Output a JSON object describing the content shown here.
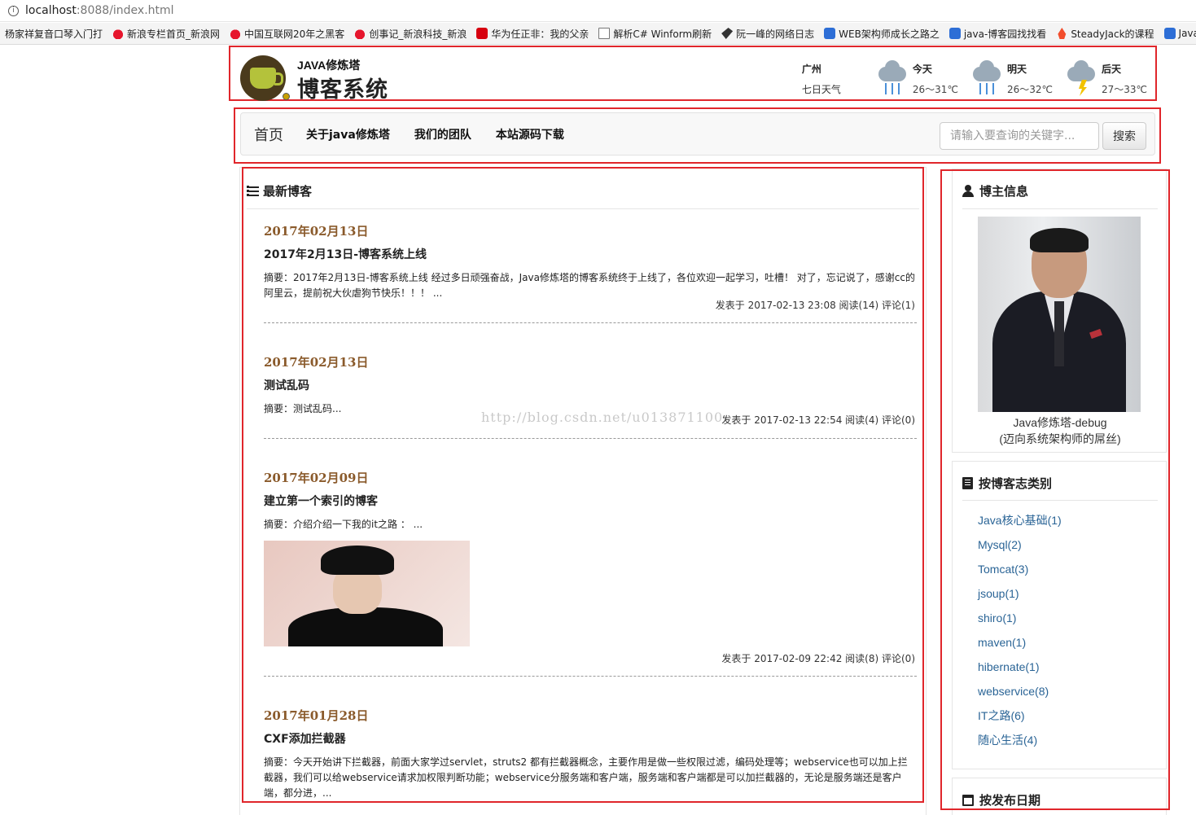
{
  "browser": {
    "url_host": "localhost",
    "url_rest": ":8088/index.html",
    "bookmarks": [
      {
        "icon": "plain",
        "label": "杨家祥复音口琴入门打"
      },
      {
        "icon": "weibo",
        "label": "新浪专栏首页_新浪网"
      },
      {
        "icon": "weibo",
        "label": "中国互联网20年之黑客"
      },
      {
        "icon": "weibo",
        "label": "创事记_新浪科技_新浪"
      },
      {
        "icon": "it",
        "label": "华为任正非：我的父亲"
      },
      {
        "icon": "doc",
        "label": "解析C# Winform刷新"
      },
      {
        "icon": "bird",
        "label": "阮一峰的网络日志"
      },
      {
        "icon": "blue",
        "label": "WEB架构师成长之路之"
      },
      {
        "icon": "blue",
        "label": "java-博客园找找看"
      },
      {
        "icon": "flame",
        "label": "SteadyJack的课程"
      },
      {
        "icon": "blue",
        "label": "Java"
      }
    ]
  },
  "header": {
    "logo_sub": "JAVA修炼塔",
    "logo_title": "博客系统",
    "weather": {
      "city": "广州",
      "subtitle": "七日天气",
      "days": [
        {
          "day": "今天",
          "temp": "26～31℃",
          "icon": "rain-icon"
        },
        {
          "day": "明天",
          "temp": "26～32℃",
          "icon": "rain-icon"
        },
        {
          "day": "后天",
          "temp": "27～33℃",
          "icon": "thunderstorm-icon"
        }
      ]
    }
  },
  "nav": {
    "brand": "首页",
    "links": [
      "关于java修炼塔",
      "我们的团队",
      "本站源码下载"
    ],
    "search_placeholder": "请输入要查询的关键字...",
    "search_button": "搜索"
  },
  "blog": {
    "heading": "最新博客",
    "watermark": "http://blog.csdn.net/u013871100",
    "posts": [
      {
        "date": "2017年02月13日",
        "title": "2017年2月13日-博客系统上线",
        "summary": "摘要：2017年2月13日-博客系统上线 经过多日顽强奋战，Java修炼塔的博客系统终于上线了，各位欢迎一起学习，吐槽！ 对了，忘记说了，感谢cc的阿里云，提前祝大伙虐狗节快乐！！！ ...",
        "meta": "发表于 2017-02-13 23:08 阅读(14) 评论(1)"
      },
      {
        "date": "2017年02月13日",
        "title": "测试乱码",
        "summary": "摘要：测试乱码...",
        "meta": "发表于 2017-02-13 22:54 阅读(4) 评论(0)"
      },
      {
        "date": "2017年02月09日",
        "title": "建立第一个索引的博客",
        "summary": "摘要：介绍介绍一下我的it之路 ： ...",
        "meta": "发表于 2017-02-09 22:42 阅读(8) 评论(0)"
      },
      {
        "date": "2017年01月28日",
        "title": "CXF添加拦截器",
        "summary": "摘要：今天开始讲下拦截器，前面大家学过servlet，struts2 都有拦截器概念，主要作用是做一些权限过滤，编码处理等；webservice也可以加上拦截器，我们可以给webservice请求加权限判断功能；webservice分服务端和客户端，服务端和客户端都是可以加拦截器的，无论是服务端还是客户端，都分进，...",
        "meta": ""
      }
    ]
  },
  "sidebar": {
    "blogger": {
      "heading": "博主信息",
      "name": "Java修炼塔-debug",
      "tagline": "(迈向系统架构师的屌丝)"
    },
    "categories": {
      "heading": "按博客志类别",
      "items": [
        "Java核心基础(1)",
        "Mysql(2)",
        "Tomcat(3)",
        "jsoup(1)",
        "shiro(1)",
        "maven(1)",
        "hibernate(1)",
        "webservice(8)",
        "IT之路(6)",
        "随心生活(4)"
      ]
    },
    "dates": {
      "heading": "按发布日期"
    }
  }
}
